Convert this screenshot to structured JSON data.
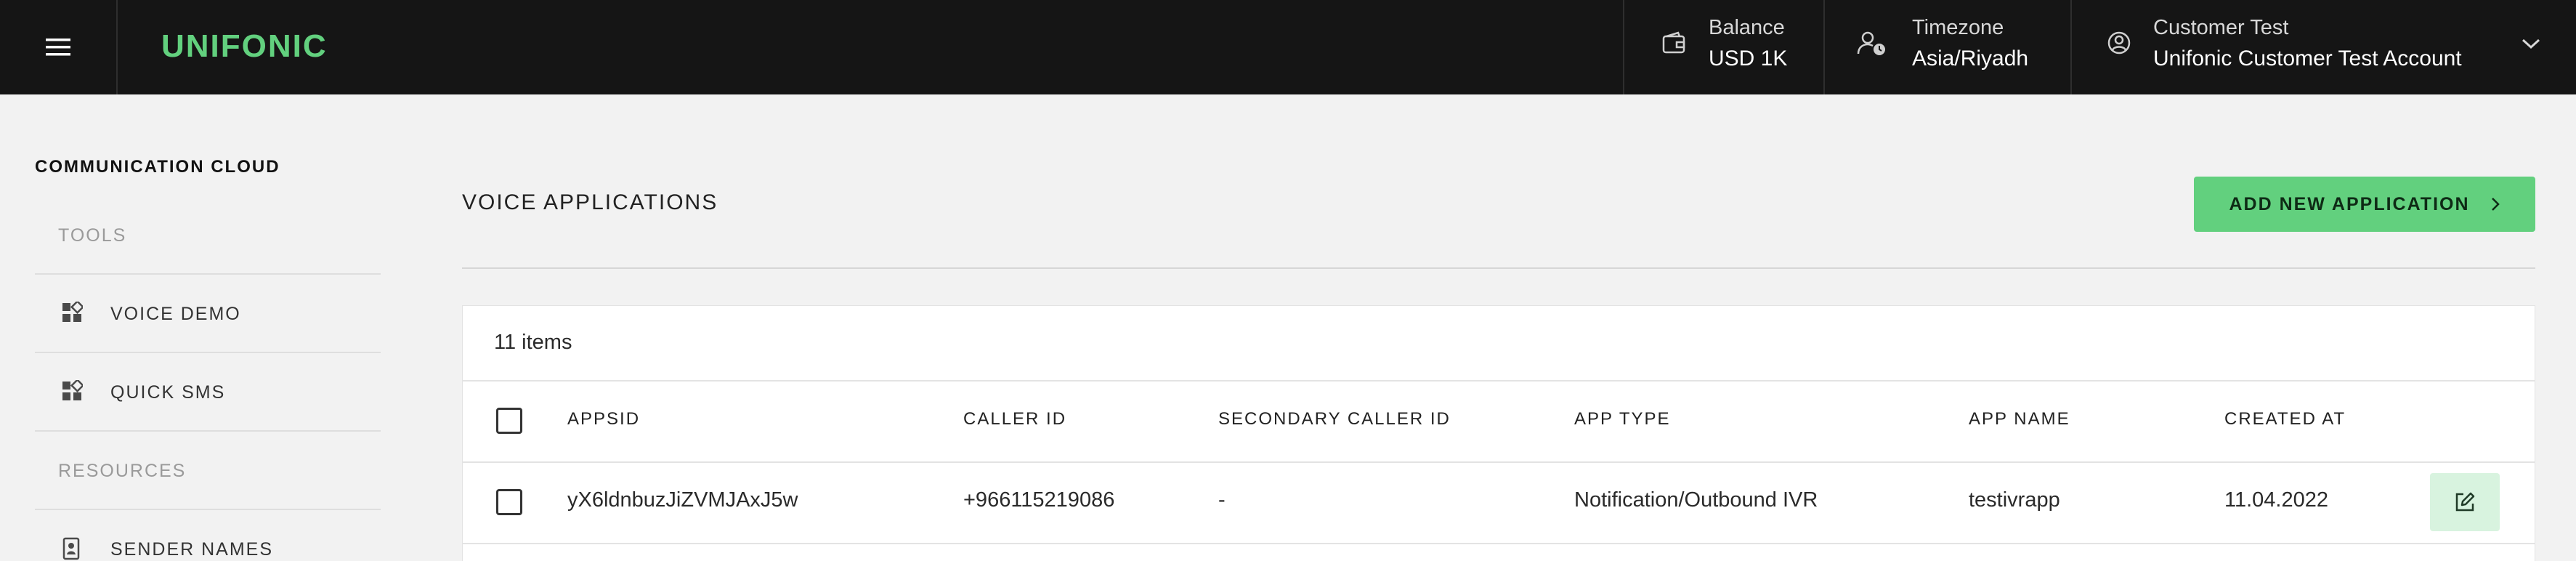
{
  "topbar": {
    "logo": "UNIFONIC",
    "balance_label": "Balance",
    "balance_value": "USD 1K",
    "timezone_label": "Timezone",
    "timezone_value": "Asia/Riyadh",
    "account_label": "Customer Test",
    "account_value": "Unifonic Customer Test Account"
  },
  "sidebar": {
    "title": "COMMUNICATION CLOUD",
    "tools_label": "TOOLS",
    "items": [
      {
        "label": "VOICE DEMO"
      },
      {
        "label": "QUICK SMS"
      }
    ],
    "resources_label": "RESOURCES",
    "resources_items": [
      {
        "label": "SENDER NAMES"
      }
    ]
  },
  "main": {
    "title": "VOICE APPLICATIONS",
    "add_button": "ADD NEW APPLICATION",
    "items_count": "11 items",
    "columns": [
      "APPSID",
      "CALLER ID",
      "SECONDARY CALLER ID",
      "APP TYPE",
      "APP NAME",
      "CREATED AT"
    ],
    "rows": [
      {
        "appsid": "yX6ldnbuzJiZVMJAxJ5w",
        "caller_id": "+966115219086",
        "secondary_caller_id": "-",
        "app_type": "Notification/Outbound IVR",
        "app_name": "testivrapp",
        "created_at": "11.04.2022"
      }
    ]
  },
  "colors": {
    "accent": "#62d07e",
    "topbar_bg": "#151515",
    "page_bg": "#f2f2f2"
  },
  "icons": [
    "menu-icon",
    "wallet-icon",
    "user-clock-icon",
    "user-circle-icon",
    "chevron-down-icon",
    "widgets-icon",
    "contact-icon",
    "chevron-right-icon",
    "edit-icon"
  ]
}
